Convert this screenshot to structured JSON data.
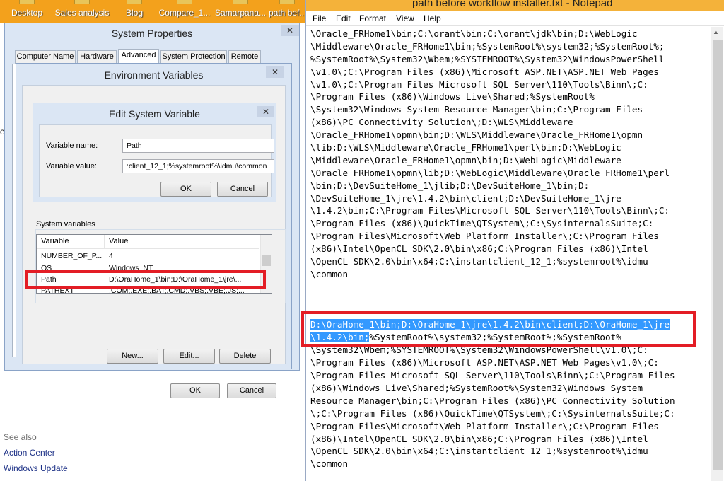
{
  "desktop": {
    "icons": [
      "Desktop",
      "Sales analysis",
      "Blog",
      "Compare_1...",
      "Samarpana...",
      "path bef..."
    ]
  },
  "control_panel": {
    "see_also_label": "See also",
    "links": [
      "Action Center",
      "Windows Update"
    ],
    "partial_text": "e"
  },
  "system_properties": {
    "title": "System Properties",
    "close_symbol": "✕",
    "tabs": [
      "Computer Name",
      "Hardware",
      "Advanced",
      "System Protection",
      "Remote"
    ],
    "active_tab": "Advanced"
  },
  "environment_variables": {
    "title": "Environment Variables",
    "close_symbol": "✕",
    "system_variables_label": "System variables",
    "columns": [
      "Variable",
      "Value"
    ],
    "rows": [
      {
        "variable": "NUMBER_OF_P...",
        "value": "4"
      },
      {
        "variable": "OS",
        "value": "Windows_NT"
      },
      {
        "variable": "Path",
        "value": "D:\\OraHome_1\\bin;D:\\OraHome_1\\jre\\..."
      },
      {
        "variable": "PATHEXT",
        "value": ".COM;.EXE;.BAT;.CMD;.VBS;.VBE;.JS;..."
      }
    ],
    "selected_variable": "Path",
    "buttons": {
      "new": "New...",
      "edit": "Edit...",
      "delete": "Delete",
      "ok": "OK",
      "cancel": "Cancel"
    }
  },
  "edit_variable": {
    "title": "Edit System Variable",
    "close_symbol": "✕",
    "name_label": "Variable name:",
    "name_value": "Path",
    "value_label": "Variable value:",
    "value_value": ":client_12_1;%systemroot%\\idmu\\common",
    "buttons": {
      "ok": "OK",
      "cancel": "Cancel"
    }
  },
  "notepad": {
    "title": "path before workflow installer.txt - Notepad",
    "menus": [
      "File",
      "Edit",
      "Format",
      "View",
      "Help"
    ],
    "text_before": [
      "\\Oracle_FRHome1\\bin;C:\\orant\\bin;C:\\orant\\jdk\\bin;D:\\WebLogic",
      "\\Middleware\\Oracle_FRHome1\\bin;%SystemRoot%\\system32;%SystemRoot%;",
      "%SystemRoot%\\System32\\Wbem;%SYSTEMROOT%\\System32\\WindowsPowerShell",
      "\\v1.0\\;C:\\Program Files (x86)\\Microsoft ASP.NET\\ASP.NET Web Pages",
      "\\v1.0\\;C:\\Program Files Microsoft SQL Server\\110\\Tools\\Binn\\;C:",
      "\\Program Files (x86)\\Windows Live\\Shared;%SystemRoot%",
      "\\System32\\Windows System Resource Manager\\bin;C:\\Program Files",
      "(x86)\\PC Connectivity Solution\\;D:\\WLS\\Middleware",
      "\\Oracle_FRHome1\\opmn\\bin;D:\\WLS\\Middleware\\Oracle_FRHome1\\opmn",
      "\\lib;D:\\WLS\\Middleware\\Oracle_FRHome1\\perl\\bin;D:\\WebLogic",
      "\\Middleware\\Oracle_FRHome1\\opmn\\bin;D:\\WebLogic\\Middleware",
      "\\Oracle_FRHome1\\opmn\\lib;D:\\WebLogic\\Middleware\\Oracle_FRHome1\\perl",
      "\\bin;D:\\DevSuiteHome_1\\jlib;D:\\DevSuiteHome_1\\bin;D:",
      "\\DevSuiteHome_1\\jre\\1.4.2\\bin\\client;D:\\DevSuiteHome_1\\jre",
      "\\1.4.2\\bin;C:\\Program Files\\Microsoft SQL Server\\110\\Tools\\Binn\\;C:",
      "\\Program Files (x86)\\QuickTime\\QTSystem\\;C:\\SysinternalsSuite;C:",
      "\\Program Files\\Microsoft\\Web Platform Installer\\;C:\\Program Files",
      "(x86)\\Intel\\OpenCL SDK\\2.0\\bin\\x86;C:\\Program Files (x86)\\Intel",
      "\\OpenCL SDK\\2.0\\bin\\x64;C:\\instantclient_12_1;%systemroot%\\idmu",
      "\\common"
    ],
    "selected_line1": "D:\\OraHome_1\\bin;D:\\OraHome_1\\jre\\1.4.2\\bin\\client;D:\\OraHome_1\\jre",
    "selected_line2": "\\1.4.2\\bin;",
    "line2_rest": "%SystemRoot%\\system32;%SystemRoot%;%SystemRoot%",
    "text_after": [
      "\\System32\\Wbem;%SYSTEMROOT%\\System32\\WindowsPowerShell\\v1.0\\;C:",
      "\\Program Files (x86)\\Microsoft ASP.NET\\ASP.NET Web Pages\\v1.0\\;C:",
      "\\Program Files Microsoft SQL Server\\110\\Tools\\Binn\\;C:\\Program Files",
      "(x86)\\Windows Live\\Shared;%SystemRoot%\\System32\\Windows System",
      "Resource Manager\\bin;C:\\Program Files (x86)\\PC Connectivity Solution",
      "\\;C:\\Program Files (x86)\\QuickTime\\QTSystem\\;C:\\SysinternalsSuite;C:",
      "\\Program Files\\Microsoft\\Web Platform Installer\\;C:\\Program Files",
      "(x86)\\Intel\\OpenCL SDK\\2.0\\bin\\x86;C:\\Program Files (x86)\\Intel",
      "\\OpenCL SDK\\2.0\\bin\\x64;C:\\instantclient_12_1;%systemroot%\\idmu",
      "\\common"
    ],
    "highlight_color": "#e31d25",
    "selection_color": "#3399ff"
  }
}
